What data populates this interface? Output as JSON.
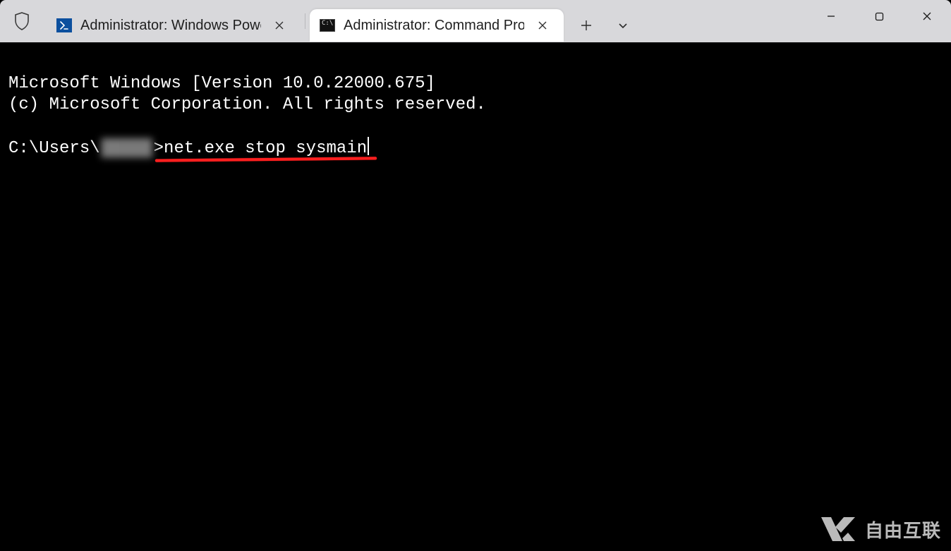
{
  "titlebar": {
    "tabs": [
      {
        "title": "Administrator: Windows Powe",
        "icon": "powershell-icon",
        "active": false
      },
      {
        "title": "Administrator: Command Pro",
        "icon": "cmd-icon",
        "active": true
      }
    ],
    "new_tab_tooltip": "New tab",
    "tab_menu_tooltip": "Tab options"
  },
  "window_controls": {
    "minimize": "Minimize",
    "maximize": "Maximize",
    "close": "Close"
  },
  "terminal": {
    "banner_line1": "Microsoft Windows [Version 10.0.22000.675]",
    "banner_line2": "(c) Microsoft Corporation. All rights reserved.",
    "prompt_prefix": "C:\\Users\\",
    "prompt_user_obscured": "█████",
    "prompt_suffix": ">",
    "command": "net.exe stop sysmain"
  },
  "annotation": {
    "underline_color": "#ff1f1f"
  },
  "watermark": {
    "text": "自由互联"
  }
}
